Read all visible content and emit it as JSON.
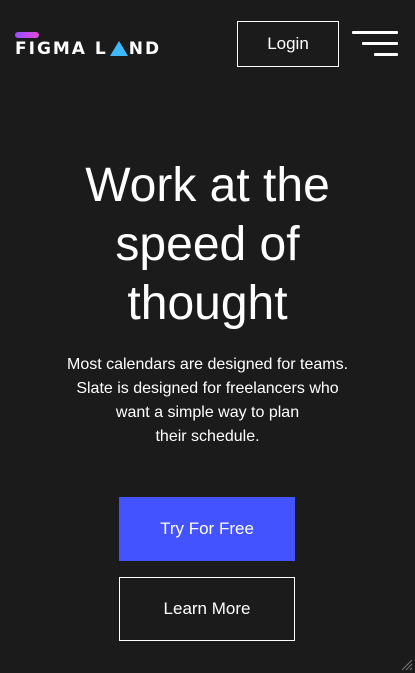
{
  "header": {
    "logo_left": "FIGMA L",
    "logo_right": "ND",
    "login_label": "Login"
  },
  "hero": {
    "title_line1": "Work at the",
    "title_line2": "speed of",
    "title_line3": "thought",
    "subtitle_line1": "Most calendars are designed for teams.",
    "subtitle_line2": "Slate is designed for freelancers who",
    "subtitle_line3": "want a simple way to plan",
    "subtitle_line4": "their schedule.",
    "primary_cta": "Try For Free",
    "secondary_cta": "Learn More"
  },
  "icons": {
    "menu": "hamburger-menu-icon",
    "logo_mark": "triangle-icon",
    "resize": "resize-grip-icon"
  },
  "colors": {
    "background": "#1b1b1b",
    "primary": "#4353ff",
    "logo_accent": "#3db9ff",
    "logo_bar": "#c64ee8"
  }
}
